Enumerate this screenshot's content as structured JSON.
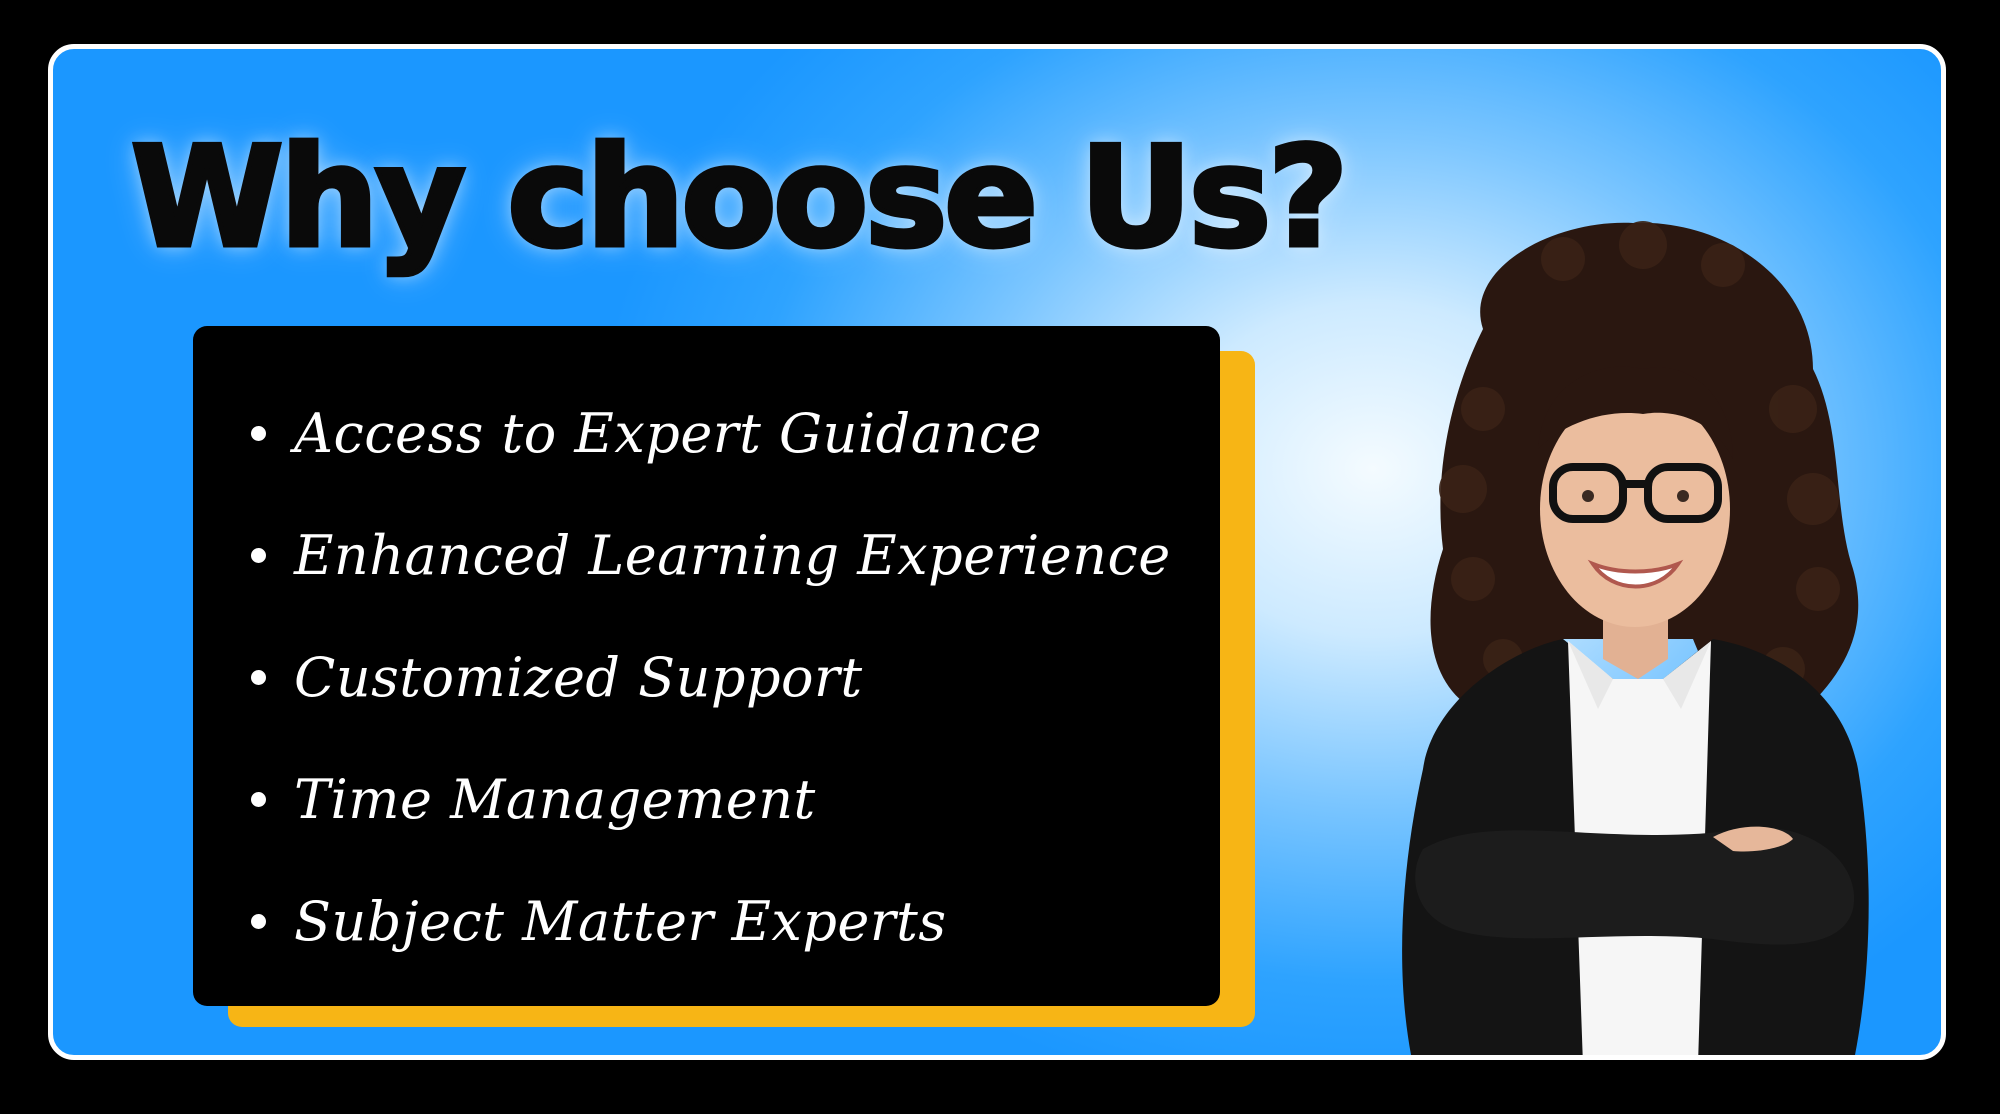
{
  "headline": "Why choose Us?",
  "features": [
    "Access to Expert Guidance",
    "Enhanced Learning Experience",
    "Customized Support",
    "Time Management",
    "Subject Matter Experts"
  ],
  "colors": {
    "page_background": "#000000",
    "card_border": "#ffffff",
    "card_gradient_center": "#f4fbff",
    "card_gradient_edge": "#1b97ff",
    "headline_text": "#0a0a0a",
    "panel_background": "#000000",
    "panel_accent": "#f7b515",
    "feature_text": "#ffffff"
  }
}
